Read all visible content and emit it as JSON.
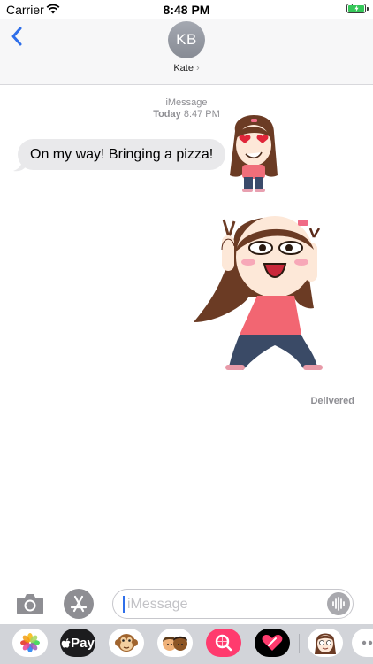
{
  "status": {
    "carrier": "Carrier",
    "time": "8:48 PM"
  },
  "header": {
    "avatar_initials": "KB",
    "contact_name": "Kate",
    "contact_chevron": "›"
  },
  "conversation": {
    "service": "iMessage",
    "day": "Today",
    "time": "8:47 PM",
    "messages": [
      {
        "direction": "incoming",
        "text": "On my way! Bringing a pizza!"
      }
    ],
    "stickers": [
      "girl-heart-eyes-sticker",
      "girl-dancing-sticker"
    ],
    "delivery_status": "Delivered"
  },
  "compose": {
    "placeholder": "iMessage"
  },
  "app_drawer": {
    "apple_pay_label": "Pay",
    "apps": [
      "photos-icon",
      "apple-pay-icon",
      "monkey-animoji-icon",
      "memoji-icon",
      "search-images-icon",
      "heart-digital-touch-icon",
      "sticker-pack-icon",
      "more-icon"
    ]
  },
  "colors": {
    "accent": "#2f6fea",
    "incoming_bubble": "#e9e9eb",
    "battery": "#35c759",
    "header_bg": "#f7f7f8"
  }
}
